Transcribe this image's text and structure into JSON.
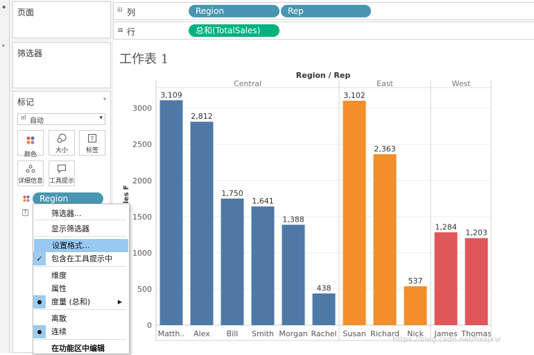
{
  "left_panel": {
    "pages_title": "页面",
    "filters_title": "筛选器",
    "marks_title": "标记",
    "mark_type": "自动",
    "mark_buttons": [
      {
        "label": "颜色",
        "icon": "color-dots-icon"
      },
      {
        "label": "大小",
        "icon": "size-icon"
      },
      {
        "label": "标签",
        "icon": "label-icon"
      },
      {
        "label": "详细信息",
        "icon": "detail-icon"
      },
      {
        "label": "工具提示",
        "icon": "tooltip-icon"
      }
    ],
    "color_pill": "Region"
  },
  "shelves": {
    "columns_label": "列",
    "rows_label": "行",
    "columns_pills": [
      "Region",
      "Rep"
    ],
    "rows_pill": "总和(TotalSales)",
    "colors": {
      "dimension_pill": "#4996b2",
      "measure_pill": "#00b180"
    }
  },
  "worksheet": {
    "title": "工作表 1"
  },
  "context_menu": {
    "items": [
      {
        "label": "筛选器...",
        "checked": false,
        "bullet": false,
        "submenu": false,
        "bold": false,
        "highlighted": false
      },
      {
        "label": "显示筛选器",
        "checked": false,
        "bullet": false,
        "submenu": false,
        "bold": false,
        "highlighted": false
      },
      {
        "label": "设置格式...",
        "checked": false,
        "bullet": false,
        "submenu": false,
        "bold": false,
        "highlighted": true
      },
      {
        "label": "包含在工具提示中",
        "checked": true,
        "bullet": false,
        "submenu": false,
        "bold": false,
        "highlighted": false
      },
      {
        "label": "维度",
        "checked": false,
        "bullet": false,
        "submenu": false,
        "bold": false,
        "highlighted": false
      },
      {
        "label": "属性",
        "checked": false,
        "bullet": false,
        "submenu": false,
        "bold": false,
        "highlighted": false
      },
      {
        "label": "度量 (总和)",
        "checked": false,
        "bullet": true,
        "submenu": true,
        "bold": false,
        "highlighted": false
      },
      {
        "label": "离散",
        "checked": false,
        "bullet": false,
        "submenu": false,
        "bold": false,
        "highlighted": false
      },
      {
        "label": "连续",
        "checked": false,
        "bullet": true,
        "submenu": false,
        "bold": false,
        "highlighted": false
      },
      {
        "label": "在功能区中编辑",
        "checked": false,
        "bullet": false,
        "submenu": false,
        "bold": true,
        "highlighted": false
      }
    ]
  },
  "watermark": "https://blog.csdn.net/hxxjxw",
  "chart_data": {
    "type": "bar",
    "title": "Region / Rep",
    "ylabel": "TotalSales",
    "ylabel_visible": "ales F",
    "ylim": [
      0,
      3400
    ],
    "yticks": [
      0,
      500,
      1000,
      1500,
      2000,
      2500,
      3000
    ],
    "grid": true,
    "groups": [
      {
        "name": "Central",
        "color": "#4e79a7",
        "categories": [
          "Matth..",
          "Alex",
          "Bill",
          "Smith",
          "Morgan",
          "Rachel"
        ],
        "values": [
          3109,
          2812,
          1750,
          1641,
          1388,
          438
        ],
        "labels": [
          "3,109",
          "2,812",
          "1,750",
          "1,641",
          "1,388",
          "438"
        ]
      },
      {
        "name": "East",
        "color": "#f28e2b",
        "categories": [
          "Susan",
          "Richard",
          "Nick"
        ],
        "values": [
          3102,
          2363,
          537
        ],
        "labels": [
          "3,102",
          "2,363",
          "537"
        ]
      },
      {
        "name": "West",
        "color": "#e15759",
        "categories": [
          "James",
          "Thomas"
        ],
        "values": [
          1284,
          1203
        ],
        "labels": [
          "1,284",
          "1,203"
        ]
      }
    ]
  }
}
